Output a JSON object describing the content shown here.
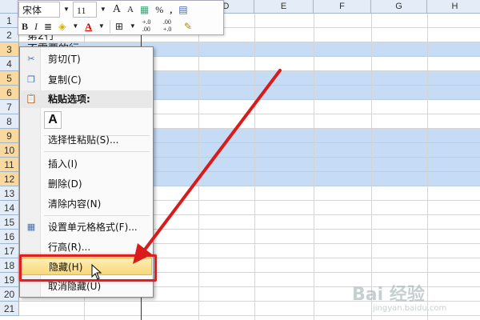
{
  "toolbar": {
    "font_name": "宋体",
    "font_size": "11",
    "grow_font": "A",
    "shrink_font": "A",
    "percent": "%",
    "comma": ",",
    "bold": "B",
    "italic": "I",
    "font_color": "A",
    "dec_increase": "+.0 .00",
    "dec_decrease": ".00 +.0"
  },
  "columns": [
    "D",
    "E",
    "F",
    "G",
    "H"
  ],
  "rows": [
    "1",
    "2",
    "3",
    "4",
    "5",
    "6",
    "7",
    "8",
    "9",
    "10",
    "11",
    "12",
    "13",
    "14",
    "15",
    "16",
    "17",
    "18",
    "19",
    "20",
    "21"
  ],
  "selected_rows": [
    "3",
    "5",
    "6",
    "9",
    "10",
    "11",
    "12"
  ],
  "cells": {
    "a2": "第2行",
    "a3": "不需要的行"
  },
  "context_menu": {
    "cut": "剪切(T)",
    "copy": "复制(C)",
    "paste_options": "粘贴选项:",
    "paste_a": "A",
    "paste_special": "选择性粘贴(S)...",
    "insert": "插入(I)",
    "delete": "删除(D)",
    "clear": "清除内容(N)",
    "format_cells": "设置单元格格式(F)...",
    "row_height": "行高(R)...",
    "hide": "隐藏(H)",
    "unhide": "取消隐藏(U)"
  },
  "watermark": {
    "text": "Bai 经验",
    "sub": "jingyan.baidu.com"
  },
  "colors": {
    "selection": "#c6dcf4",
    "highlight": "#f8d87a",
    "annotation_red": "#e02020"
  }
}
